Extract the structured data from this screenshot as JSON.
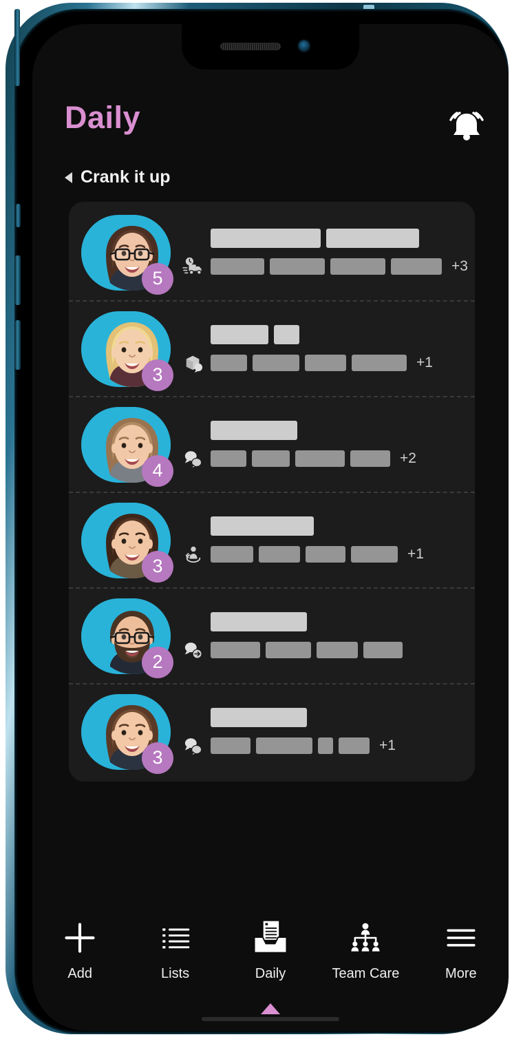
{
  "header": {
    "title": "Daily",
    "title_color": "#d98fd0",
    "bell_icon": "notification-bell-icon"
  },
  "subheader": {
    "caret_icon": "caret-left-icon",
    "title": "Crank it up"
  },
  "list": {
    "rows": [
      {
        "avatar": "woman-glasses-brown-hair-avatar",
        "badge": "5",
        "icon": "delivery-truck-clock-icon",
        "top_bars": [
          160,
          135
        ],
        "sub_bars": [
          78,
          80,
          80,
          74
        ],
        "more": "+3"
      },
      {
        "avatar": "woman-blonde-avatar",
        "badge": "3",
        "icon": "package-message-icon",
        "top_bars": [
          84,
          37
        ],
        "sub_bars": [
          53,
          68,
          60,
          80
        ],
        "more": "+1"
      },
      {
        "avatar": "woman-light-brown-hair-avatar",
        "badge": "4",
        "icon": "two-speech-bubbles-icon",
        "top_bars": [
          126
        ],
        "sub_bars": [
          52,
          55,
          72,
          58
        ],
        "more": "+2"
      },
      {
        "avatar": "woman-dark-brown-hair-avatar",
        "badge": "3",
        "icon": "person-reassign-icon",
        "top_bars": [
          150
        ],
        "sub_bars": [
          62,
          60,
          58,
          68
        ],
        "more": "+1"
      },
      {
        "avatar": "man-beard-glasses-avatar",
        "badge": "2",
        "icon": "speech-bubble-arrow-icon",
        "top_bars": [
          140
        ],
        "sub_bars": [
          72,
          66,
          60,
          57
        ],
        "more": ""
      },
      {
        "avatar": "woman-wavy-brown-hair-avatar",
        "badge": "3",
        "icon": "two-speech-bubbles-icon",
        "top_bars": [
          140
        ],
        "sub_bars": [
          58,
          82,
          22,
          45
        ],
        "more": "+1"
      }
    ]
  },
  "tab_bar": {
    "items": [
      {
        "label": "Add",
        "icon": "plus-icon",
        "active": false
      },
      {
        "label": "Lists",
        "icon": "bullet-list-icon",
        "active": false
      },
      {
        "label": "Daily",
        "icon": "inbox-tray-icon",
        "active": true
      },
      {
        "label": "Team Care",
        "icon": "org-chart-icon",
        "active": false
      },
      {
        "label": "More",
        "icon": "hamburger-icon",
        "active": false
      }
    ],
    "active_indicator_color": "#d98fd0"
  },
  "colors": {
    "screen_bg": "#0d0d0d",
    "card_bg": "#1c1c1c",
    "accent_pink": "#d98fd0",
    "badge_purple": "#b678bf",
    "avatar_ring_cyan": "#29b3d9",
    "bar_primary": "#cdcdcd",
    "bar_secondary": "#959595",
    "frame_blue": "#1d5c78"
  }
}
